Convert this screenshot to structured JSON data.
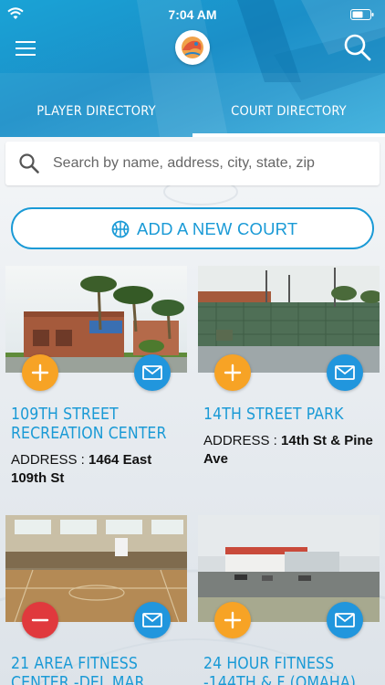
{
  "status_bar": {
    "time": "7:04 AM"
  },
  "header": {
    "tabs": [
      {
        "label": "PLAYER DIRECTORY",
        "active": false
      },
      {
        "label": "COURT DIRECTORY",
        "active": true
      }
    ],
    "accent_color": "#1a9ad6"
  },
  "search": {
    "placeholder": "Search by name, address, city, state, zip",
    "value": ""
  },
  "add_court": {
    "label": "ADD A NEW COURT",
    "icon": "basketball-icon"
  },
  "address_prefix": "ADDRESS :",
  "courts": [
    {
      "name": "109TH STREET RECREATION CENTER",
      "address": "1464 East 109th St",
      "action": "add",
      "icon": "mail-icon"
    },
    {
      "name": "14TH STREET PARK",
      "address": "14th St & Pine Ave",
      "action": "add",
      "icon": "mail-icon"
    },
    {
      "name": "21 AREA FITNESS CENTER -DEL MAR",
      "address": "",
      "action": "remove",
      "icon": "mail-icon"
    },
    {
      "name": "24 HOUR FITNESS -144TH & F (OMAHA)",
      "address": "",
      "action": "add",
      "icon": "mail-icon"
    }
  ],
  "colors": {
    "add": "#f7a325",
    "remove": "#e0393d",
    "mail": "#2196dd"
  }
}
